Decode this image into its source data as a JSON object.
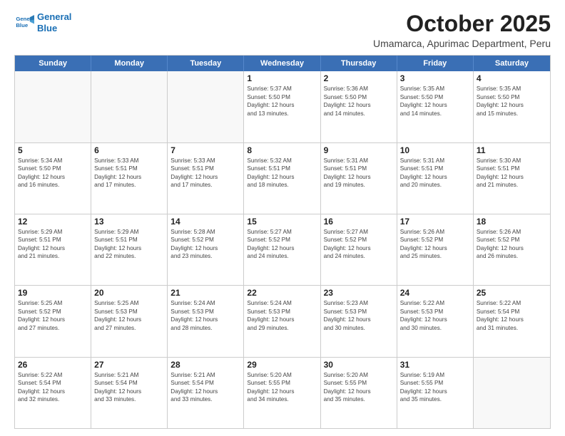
{
  "logo": {
    "line1": "General",
    "line2": "Blue"
  },
  "title": "October 2025",
  "subtitle": "Umamarca, Apurimac Department, Peru",
  "dayNames": [
    "Sunday",
    "Monday",
    "Tuesday",
    "Wednesday",
    "Thursday",
    "Friday",
    "Saturday"
  ],
  "rows": [
    [
      {
        "date": "",
        "info": ""
      },
      {
        "date": "",
        "info": ""
      },
      {
        "date": "",
        "info": ""
      },
      {
        "date": "1",
        "info": "Sunrise: 5:37 AM\nSunset: 5:50 PM\nDaylight: 12 hours\nand 13 minutes."
      },
      {
        "date": "2",
        "info": "Sunrise: 5:36 AM\nSunset: 5:50 PM\nDaylight: 12 hours\nand 14 minutes."
      },
      {
        "date": "3",
        "info": "Sunrise: 5:35 AM\nSunset: 5:50 PM\nDaylight: 12 hours\nand 14 minutes."
      },
      {
        "date": "4",
        "info": "Sunrise: 5:35 AM\nSunset: 5:50 PM\nDaylight: 12 hours\nand 15 minutes."
      }
    ],
    [
      {
        "date": "5",
        "info": "Sunrise: 5:34 AM\nSunset: 5:50 PM\nDaylight: 12 hours\nand 16 minutes."
      },
      {
        "date": "6",
        "info": "Sunrise: 5:33 AM\nSunset: 5:51 PM\nDaylight: 12 hours\nand 17 minutes."
      },
      {
        "date": "7",
        "info": "Sunrise: 5:33 AM\nSunset: 5:51 PM\nDaylight: 12 hours\nand 17 minutes."
      },
      {
        "date": "8",
        "info": "Sunrise: 5:32 AM\nSunset: 5:51 PM\nDaylight: 12 hours\nand 18 minutes."
      },
      {
        "date": "9",
        "info": "Sunrise: 5:31 AM\nSunset: 5:51 PM\nDaylight: 12 hours\nand 19 minutes."
      },
      {
        "date": "10",
        "info": "Sunrise: 5:31 AM\nSunset: 5:51 PM\nDaylight: 12 hours\nand 20 minutes."
      },
      {
        "date": "11",
        "info": "Sunrise: 5:30 AM\nSunset: 5:51 PM\nDaylight: 12 hours\nand 21 minutes."
      }
    ],
    [
      {
        "date": "12",
        "info": "Sunrise: 5:29 AM\nSunset: 5:51 PM\nDaylight: 12 hours\nand 21 minutes."
      },
      {
        "date": "13",
        "info": "Sunrise: 5:29 AM\nSunset: 5:51 PM\nDaylight: 12 hours\nand 22 minutes."
      },
      {
        "date": "14",
        "info": "Sunrise: 5:28 AM\nSunset: 5:52 PM\nDaylight: 12 hours\nand 23 minutes."
      },
      {
        "date": "15",
        "info": "Sunrise: 5:27 AM\nSunset: 5:52 PM\nDaylight: 12 hours\nand 24 minutes."
      },
      {
        "date": "16",
        "info": "Sunrise: 5:27 AM\nSunset: 5:52 PM\nDaylight: 12 hours\nand 24 minutes."
      },
      {
        "date": "17",
        "info": "Sunrise: 5:26 AM\nSunset: 5:52 PM\nDaylight: 12 hours\nand 25 minutes."
      },
      {
        "date": "18",
        "info": "Sunrise: 5:26 AM\nSunset: 5:52 PM\nDaylight: 12 hours\nand 26 minutes."
      }
    ],
    [
      {
        "date": "19",
        "info": "Sunrise: 5:25 AM\nSunset: 5:52 PM\nDaylight: 12 hours\nand 27 minutes."
      },
      {
        "date": "20",
        "info": "Sunrise: 5:25 AM\nSunset: 5:53 PM\nDaylight: 12 hours\nand 27 minutes."
      },
      {
        "date": "21",
        "info": "Sunrise: 5:24 AM\nSunset: 5:53 PM\nDaylight: 12 hours\nand 28 minutes."
      },
      {
        "date": "22",
        "info": "Sunrise: 5:24 AM\nSunset: 5:53 PM\nDaylight: 12 hours\nand 29 minutes."
      },
      {
        "date": "23",
        "info": "Sunrise: 5:23 AM\nSunset: 5:53 PM\nDaylight: 12 hours\nand 30 minutes."
      },
      {
        "date": "24",
        "info": "Sunrise: 5:22 AM\nSunset: 5:53 PM\nDaylight: 12 hours\nand 30 minutes."
      },
      {
        "date": "25",
        "info": "Sunrise: 5:22 AM\nSunset: 5:54 PM\nDaylight: 12 hours\nand 31 minutes."
      }
    ],
    [
      {
        "date": "26",
        "info": "Sunrise: 5:22 AM\nSunset: 5:54 PM\nDaylight: 12 hours\nand 32 minutes."
      },
      {
        "date": "27",
        "info": "Sunrise: 5:21 AM\nSunset: 5:54 PM\nDaylight: 12 hours\nand 33 minutes."
      },
      {
        "date": "28",
        "info": "Sunrise: 5:21 AM\nSunset: 5:54 PM\nDaylight: 12 hours\nand 33 minutes."
      },
      {
        "date": "29",
        "info": "Sunrise: 5:20 AM\nSunset: 5:55 PM\nDaylight: 12 hours\nand 34 minutes."
      },
      {
        "date": "30",
        "info": "Sunrise: 5:20 AM\nSunset: 5:55 PM\nDaylight: 12 hours\nand 35 minutes."
      },
      {
        "date": "31",
        "info": "Sunrise: 5:19 AM\nSunset: 5:55 PM\nDaylight: 12 hours\nand 35 minutes."
      },
      {
        "date": "",
        "info": ""
      }
    ]
  ]
}
